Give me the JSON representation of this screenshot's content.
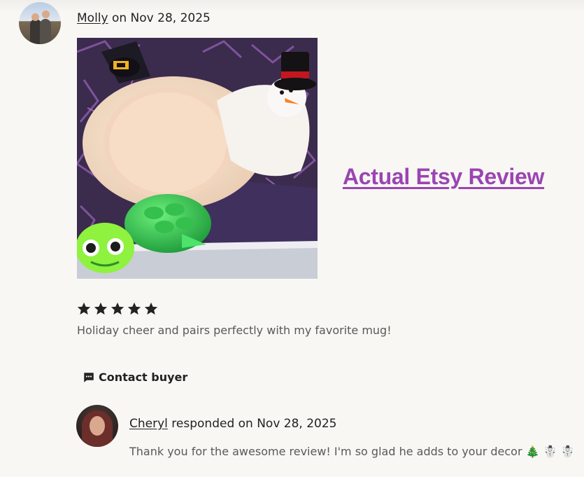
{
  "review": {
    "reviewer_name": "Molly",
    "date_text": " on Nov 28, 2025",
    "rating": 5,
    "rating_max": 5,
    "text": "Holiday cheer and pairs perfectly with my favorite mug!"
  },
  "overlay": {
    "title": "Actual Etsy Review"
  },
  "actions": {
    "contact_label": "Contact buyer"
  },
  "response": {
    "seller_name": "Cheryl",
    "date_text": " responded on Nov 28, 2025",
    "text": "Thank you for the awesome review! I'm so glad he adds to your decor 🎄 ☃️ ☃️"
  },
  "colors": {
    "page_bg": "#f8f7f4",
    "star": "#222222",
    "overlay_title": "#9b44b3",
    "secondary_text": "#595959"
  },
  "icons": {
    "star": "star-icon",
    "contact": "chat-bubble-icon"
  }
}
